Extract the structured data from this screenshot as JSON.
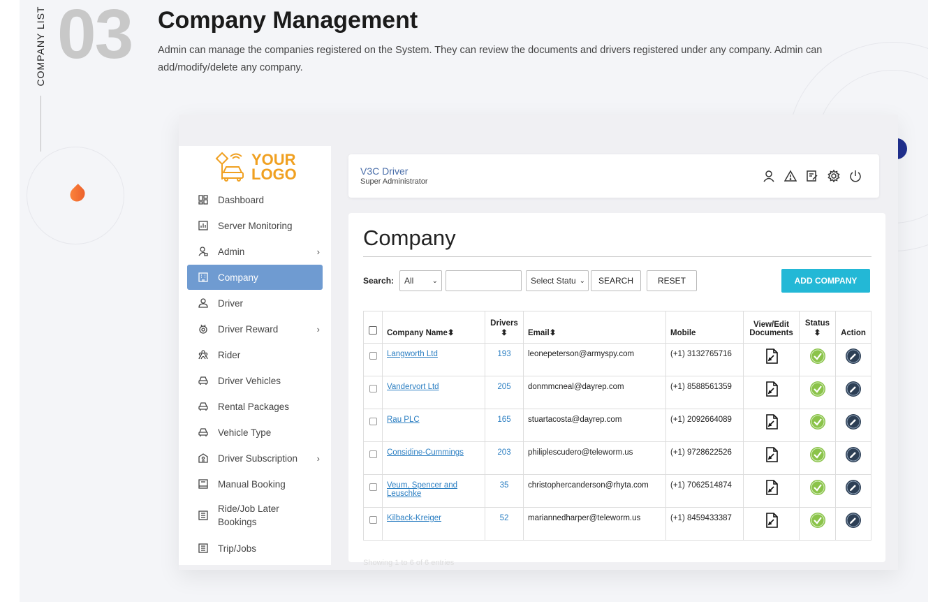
{
  "section": {
    "vertical_label": "COMPANY LIST",
    "number": "03",
    "title": "Company Management",
    "description": "Admin can manage the companies registered on the System. They can review the documents and drivers registered under any company. Admin can add/modify/delete any company."
  },
  "logo": {
    "line1": "YOUR",
    "line2": "LOGO"
  },
  "sidebar": {
    "items": [
      {
        "label": "Dashboard",
        "icon": "dashboard-icon",
        "chevron": ""
      },
      {
        "label": "Server Monitoring",
        "icon": "chart-icon",
        "chevron": ""
      },
      {
        "label": "Admin",
        "icon": "user-lock-icon",
        "chevron": "›"
      },
      {
        "label": "Company",
        "icon": "building-icon",
        "chevron": ""
      },
      {
        "label": "Driver",
        "icon": "user-icon",
        "chevron": ""
      },
      {
        "label": "Driver Reward",
        "icon": "medal-icon",
        "chevron": "›"
      },
      {
        "label": "Rider",
        "icon": "users-icon",
        "chevron": ""
      },
      {
        "label": "Driver Vehicles",
        "icon": "car-icon",
        "chevron": ""
      },
      {
        "label": "Rental Packages",
        "icon": "car-icon",
        "chevron": ""
      },
      {
        "label": "Vehicle Type",
        "icon": "car-icon",
        "chevron": ""
      },
      {
        "label": "Driver Subscription",
        "icon": "subscription-icon",
        "chevron": "›"
      },
      {
        "label": "Manual Booking",
        "icon": "book-icon",
        "chevron": ""
      },
      {
        "label": "Ride/Job Later Bookings",
        "icon": "list-icon",
        "chevron": ""
      },
      {
        "label": "Trip/Jobs",
        "icon": "list-icon",
        "chevron": ""
      }
    ]
  },
  "header": {
    "name": "V3C Driver",
    "role": "Super Administrator",
    "icons": [
      "profile-icon",
      "alert-icon",
      "edit-icon",
      "settings-icon",
      "power-icon"
    ]
  },
  "page": {
    "title": "Company",
    "search_label": "Search:",
    "filter_value": "All",
    "search_value": "",
    "status_value": "Select Statu",
    "search_button": "SEARCH",
    "reset_button": "RESET",
    "add_button": "ADD COMPANY"
  },
  "table": {
    "headers": {
      "company": "Company Name",
      "drivers_line1": "Drivers",
      "email": "Email",
      "mobile": "Mobile",
      "docs_line1": "View/Edit",
      "docs_line2": "Documents",
      "status_line1": "Status",
      "action": "Action",
      "sort": "⬍"
    },
    "rows": [
      {
        "company": "Langworth Ltd",
        "drivers": "193",
        "email": "leonepeterson@armyspy.com",
        "mobile": "(+1) 3132765716"
      },
      {
        "company": "Vandervort Ltd",
        "drivers": "205",
        "email": "donmmcneal@dayrep.com",
        "mobile": "(+1) 8588561359"
      },
      {
        "company": "Rau PLC",
        "drivers": "165",
        "email": "stuartacosta@dayrep.com",
        "mobile": "(+1) 2092664089"
      },
      {
        "company": "Considine-Cummings",
        "drivers": "203",
        "email": "philiplescudero@teleworm.us",
        "mobile": "(+1) 9728622526"
      },
      {
        "company": "Veum, Spencer and Leuschke",
        "drivers": "35",
        "email": "christophercanderson@rhyta.com",
        "mobile": "(+1) 7062514874"
      },
      {
        "company": "Kilback-Kreiger",
        "drivers": "52",
        "email": "mariannedharper@teleworm.us",
        "mobile": "(+1) 8459433387"
      }
    ]
  },
  "footer": "Showing 1 to 6 of 6 entries",
  "colors": {
    "accent": "#6f9bd1",
    "add": "#23b8d6",
    "status_ok": "#8bc34a",
    "logo": "#f0a020"
  }
}
